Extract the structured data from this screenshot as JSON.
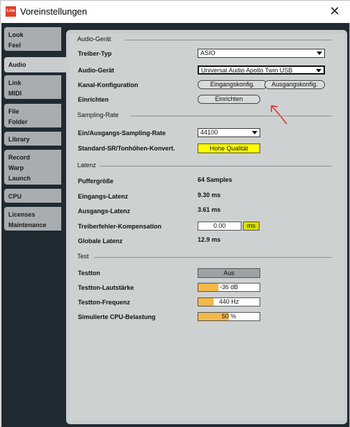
{
  "window": {
    "title": "Voreinstellungen",
    "app_icon_text": "Live",
    "close_glyph": "✕"
  },
  "sidebar": {
    "tabs": [
      {
        "lines": [
          "Look",
          "Feel"
        ]
      },
      {
        "lines": [
          "Audio"
        ],
        "active": true
      },
      {
        "lines": [
          "Link",
          "MIDI"
        ]
      },
      {
        "lines": [
          "File",
          "Folder"
        ]
      },
      {
        "lines": [
          "Library"
        ]
      },
      {
        "lines": [
          "Record",
          "Warp",
          "Launch"
        ]
      },
      {
        "lines": [
          "CPU"
        ]
      },
      {
        "lines": [
          "Licenses",
          "Maintenance"
        ]
      }
    ]
  },
  "audio_device": {
    "section": "Audio-Gerät",
    "driver_type_label": "Treiber-Typ",
    "driver_type_value": "ASIO",
    "device_label": "Audio-Gerät",
    "device_value": "Universal Audio Apollo Twin USB",
    "channel_config_label": "Kanal-Konfiguration",
    "input_config_button": "Eingangskonfig.",
    "output_config_button": "Ausgangskonfig.",
    "setup_label": "Einrichten",
    "setup_button": "Einrichten"
  },
  "sampling": {
    "section": "Sampling-Rate",
    "rate_label": "Ein/Ausgangs-Sampling-Rate",
    "rate_value": "44100",
    "default_sr_label": "Standard-SR/Tonhöhen-Konvert.",
    "default_sr_value": "Hohe Qualität"
  },
  "latency": {
    "section": "Latenz",
    "buffer_label": "Puffergröße",
    "buffer_value": "64 Samples",
    "input_latency_label": "Eingangs-Latenz",
    "input_latency_value": "9.30 ms",
    "output_latency_label": "Ausgangs-Latenz",
    "output_latency_value": "3.61 ms",
    "driver_comp_label": "Treiberfehler-Kompensation",
    "driver_comp_value": "0.00",
    "driver_comp_unit": "ms",
    "overall_label": "Globale Latenz",
    "overall_value": "12.9 ms"
  },
  "test": {
    "section": "Test",
    "tone_label": "Testton",
    "tone_value": "Aus",
    "volume_label": "Testton-Lautstärke",
    "volume_value": "-36",
    "volume_unit": "dB",
    "volume_fill": 0.33,
    "freq_label": "Testton-Frequenz",
    "freq_value": "440",
    "freq_unit": "Hz",
    "freq_fill": 0.25,
    "cpu_label": "Simulierte CPU-Belastung",
    "cpu_value": "50",
    "cpu_unit": "%",
    "cpu_fill": 0.5
  },
  "colors": {
    "sidebar_bg": "#1f2a33",
    "panel_bg": "#cdd1d2",
    "highlight_yellow": "#ffff00",
    "slider_orange": "#f3b84a",
    "annotation_red": "#e8281e"
  }
}
